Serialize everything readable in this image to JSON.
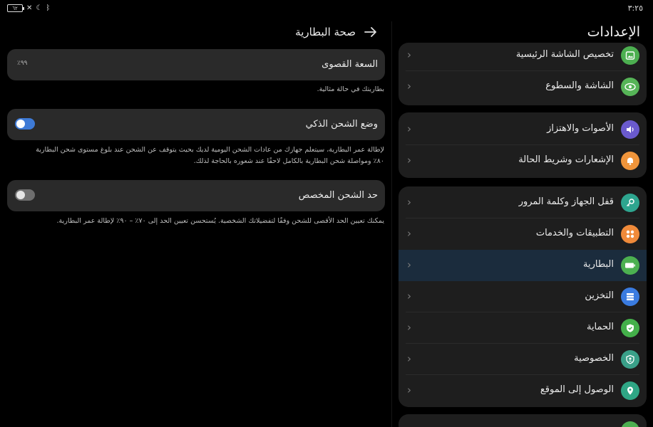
{
  "status_bar": {
    "time": "٣:٢٥",
    "battery_text": "٦٢"
  },
  "settings": {
    "title": "الإعدادات",
    "groups": [
      {
        "items": [
          {
            "label": "تخصيص الشاشة الرئيسية",
            "icon": "image-icon",
            "color": "#4caf50"
          },
          {
            "label": "الشاشة والسطوع",
            "icon": "eye-icon",
            "color": "#56b457"
          }
        ]
      },
      {
        "items": [
          {
            "label": "الأصوات والاهتزاز",
            "icon": "sound-icon",
            "color": "#6a5acd"
          },
          {
            "label": "الإشعارات وشريط الحالة",
            "icon": "bell-icon",
            "color": "#f0953b"
          }
        ]
      },
      {
        "items": [
          {
            "label": "قفل الجهاز وكلمة المرور",
            "icon": "key-icon",
            "color": "#2ea58f"
          },
          {
            "label": "التطبيقات والخدمات",
            "icon": "apps-icon",
            "color": "#f08a3a"
          },
          {
            "label": "البطارية",
            "icon": "battery-icon",
            "color": "#4cb050",
            "selected": true
          },
          {
            "label": "التخزين",
            "icon": "storage-icon",
            "color": "#3a7be0"
          },
          {
            "label": "الحماية",
            "icon": "shield-icon",
            "color": "#44b04a"
          },
          {
            "label": "الخصوصية",
            "icon": "privacy-icon",
            "color": "#3aa089"
          },
          {
            "label": "الوصول إلى الموقع",
            "icon": "location-icon",
            "color": "#2fa685"
          }
        ]
      }
    ]
  },
  "battery_protection": {
    "title": "صحة البطارية",
    "max_capacity": {
      "label": "السعة القصوى",
      "value": "٩٩٪",
      "note": "بطاريتك في حالة مثالية."
    },
    "smart_charge": {
      "label": "وضع الشحن الذكي",
      "enabled": true,
      "desc_line1": "لإطالة عمر البطارية، سيتعلم جهازك من عادات الشحن اليومية لديك بحيث يتوقف عن الشحن عند بلوغ مستوى شحن البطارية",
      "desc_line2": "٨٠٪ ومواصلة شحن البطارية بالكامل لاحقًا عند شعوره بالحاجة لذلك."
    },
    "custom_limit": {
      "label": "حد الشحن المخصص",
      "enabled": false,
      "desc": "يمكنك تعيين الحد الأقصى للشحن وفقًا لتفضيلاتك الشخصية. يُستحسن تعيين الحد إلى ٧٠٪ – ٩٠٪ لإطالة عمر البطارية."
    }
  }
}
